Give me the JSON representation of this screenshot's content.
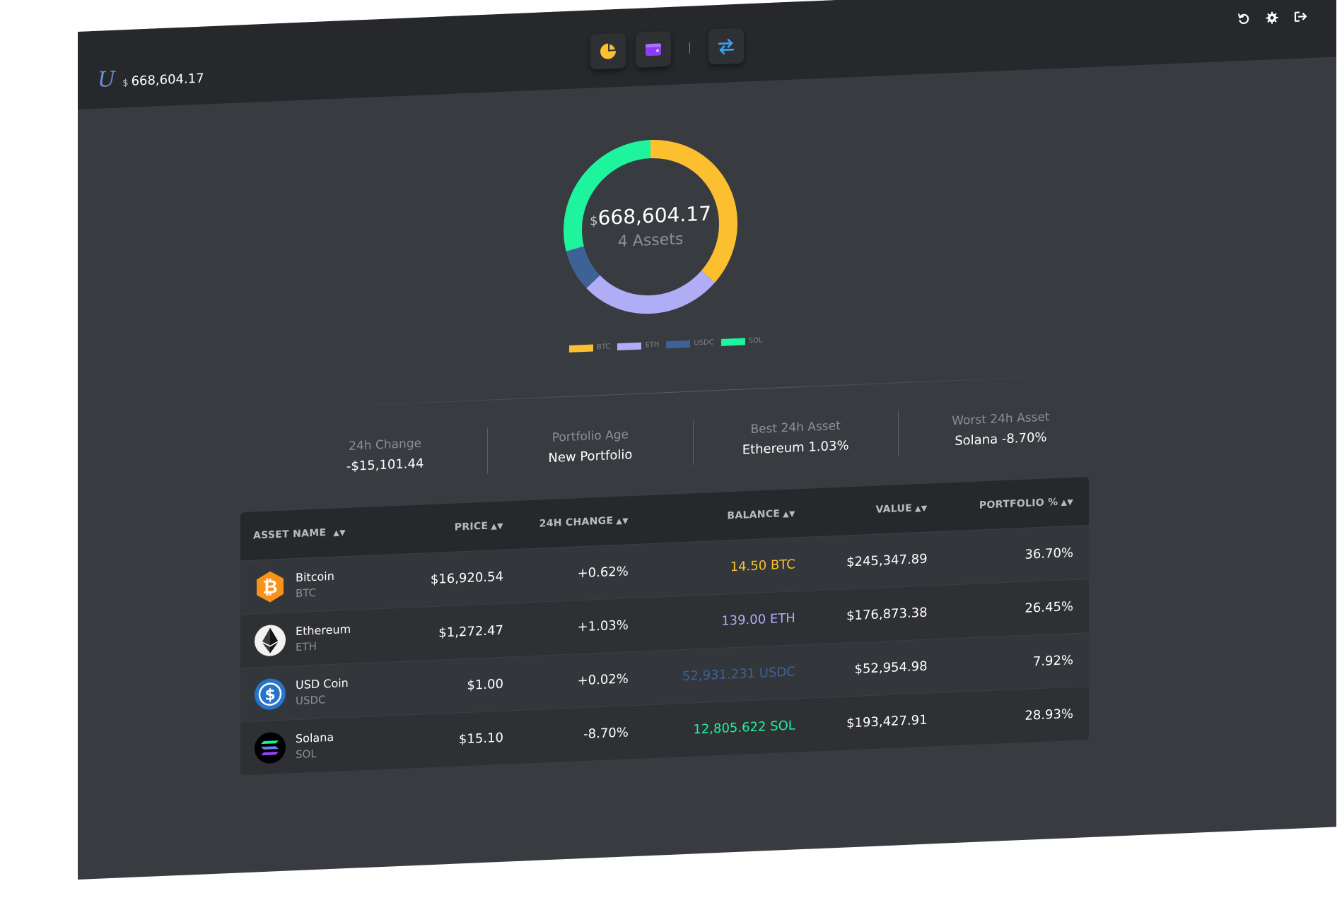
{
  "header": {
    "logo_text": "U",
    "currency_symbol": "$",
    "total": "668,604.17"
  },
  "nav": {
    "chart_icon": "pie-chart-icon",
    "wallet_icon": "wallet-icon",
    "swap_icon": "swap-arrows-icon"
  },
  "top_actions": [
    "refresh-icon",
    "gear-icon",
    "logout-icon"
  ],
  "donut": {
    "currency_symbol": "$",
    "total": "668,604.17",
    "assets_label": "4 Assets"
  },
  "chart_data": {
    "type": "pie",
    "categories": [
      "BTC",
      "ETH",
      "USDC",
      "SOL"
    ],
    "values": [
      36.7,
      26.45,
      7.92,
      28.93
    ],
    "colors": [
      "#fbbf2f",
      "#b0adf7",
      "#3f6296",
      "#1ef39d"
    ],
    "legend": "bottom"
  },
  "stats": [
    {
      "label": "24h Change",
      "value": "-$15,101.44"
    },
    {
      "label": "Portfolio Age",
      "value": "New Portfolio"
    },
    {
      "label": "Best 24h Asset",
      "value": "Ethereum 1.03%"
    },
    {
      "label": "Worst 24h Asset",
      "value": "Solana -8.70%"
    }
  ],
  "table": {
    "headers": {
      "name": "ASSET NAME",
      "price": "PRICE",
      "change": "24H CHANGE",
      "balance": "BALANCE",
      "value": "VALUE",
      "pct": "PORTFOLIO %"
    },
    "rows": [
      {
        "name": "Bitcoin",
        "symbol": "BTC",
        "price": "$16,920.54",
        "change": "+0.62%",
        "balance": "14.50 BTC",
        "balance_color": "#fbbf2f",
        "value": "$245,347.89",
        "pct": "36.70%"
      },
      {
        "name": "Ethereum",
        "symbol": "ETH",
        "price": "$1,272.47",
        "change": "+1.03%",
        "balance": "139.00 ETH",
        "balance_color": "#b0adf7",
        "value": "$176,873.38",
        "pct": "26.45%"
      },
      {
        "name": "USD Coin",
        "symbol": "USDC",
        "price": "$1.00",
        "change": "+0.02%",
        "balance": "52,931.231 USDC",
        "balance_color": "#3f6296",
        "value": "$52,954.98",
        "pct": "7.92%"
      },
      {
        "name": "Solana",
        "symbol": "SOL",
        "price": "$15.10",
        "change": "-8.70%",
        "balance": "12,805.622 SOL",
        "balance_color": "#1ef39d",
        "value": "$193,427.91",
        "pct": "28.93%"
      }
    ]
  }
}
